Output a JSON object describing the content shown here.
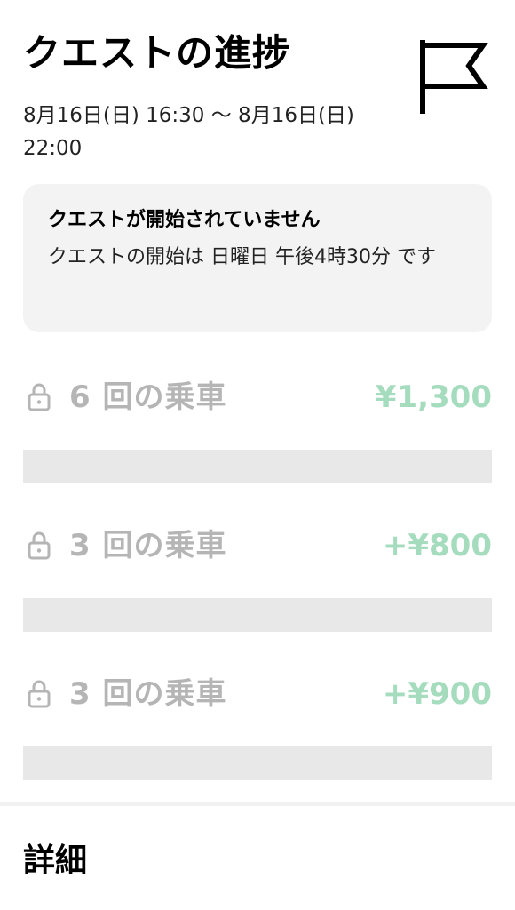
{
  "header": {
    "title": "クエストの進捗",
    "date_range": "8月16日(日) 16:30 〜 8月16日(日) 22:00"
  },
  "notice": {
    "title": "クエストが開始されていません",
    "body": "クエストの開始は 日曜日 午後4時30分 です"
  },
  "tiers": [
    {
      "label": "6 回の乗車",
      "amount": "¥1,300",
      "progress": 0,
      "locked": true
    },
    {
      "label": "3 回の乗車",
      "amount": "+¥800",
      "progress": 0,
      "locked": true
    },
    {
      "label": "3 回の乗車",
      "amount": "+¥900",
      "progress": 0,
      "locked": true
    }
  ],
  "footer": {
    "details_label": "詳細"
  },
  "colors": {
    "amount_locked": "#a5dcbe",
    "label_locked": "#b5b5b5",
    "card_background": "#f3f3f3",
    "track": "#e8e8e8"
  },
  "icons": {
    "header": "flag-icon",
    "tier": "lock-icon"
  }
}
